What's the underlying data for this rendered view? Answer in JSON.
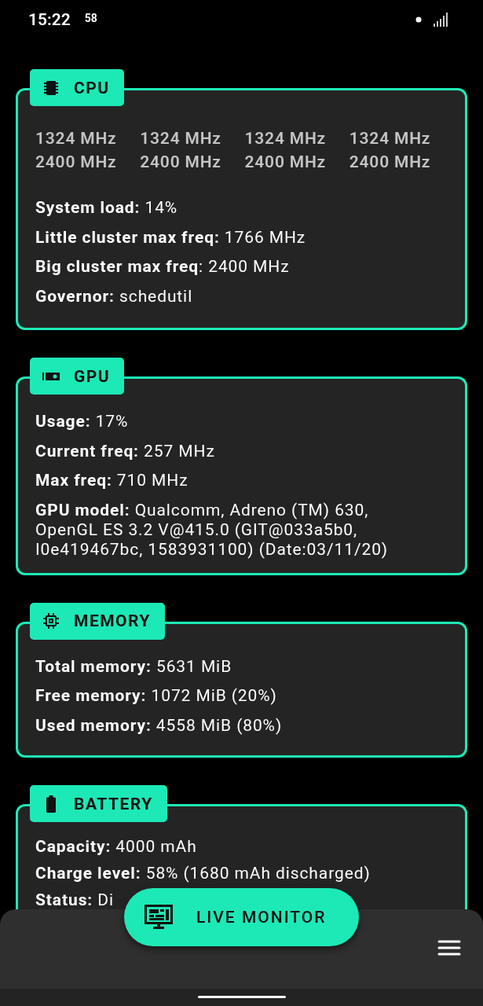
{
  "status_bar": {
    "time": "15:22",
    "notification": "58"
  },
  "sections": [
    {
      "kind": "cpu",
      "title": "CPU",
      "frequencies": [
        [
          "1324 MHz",
          "1324 MHz",
          "1324 MHz",
          "1324 MHz"
        ],
        [
          "2400 MHz",
          "2400 MHz",
          "2400 MHz",
          "2400 MHz"
        ]
      ],
      "rows": [
        "**System load:** 14%",
        "**Little cluster max freq:** 1766 MHz",
        "**Big cluster max freq**: 2400 MHz",
        "**Governor:** schedutil"
      ]
    },
    {
      "kind": "gpu",
      "title": "GPU",
      "rows": [
        "**Usage:** 17%",
        "**Current freq:** 257 MHz",
        "**Max freq:** 710 MHz",
        "**GPU model:** Qualcomm, Adreno (TM) 630, OpenGL ES 3.2 V@415.0 (GIT@033a5b0, I0e419467bc, 1583931100) (Date:03/11/20)"
      ]
    },
    {
      "kind": "memory",
      "title": "MEMORY",
      "rows": [
        "**Total memory:** 5631 MiB",
        "**Free memory:** 1072 MiB (20%)",
        "**Used memory:** 4558 MiB (80%)"
      ]
    },
    {
      "kind": "battery",
      "title": "BATTERY",
      "rows": [
        "**Capacity:** 4000 mAh",
        "**Charge level:** 58% (1680 mAh discharged)",
        "**Status:** Di"
      ]
    }
  ],
  "fab": {
    "label": "LIVE MONITOR"
  }
}
